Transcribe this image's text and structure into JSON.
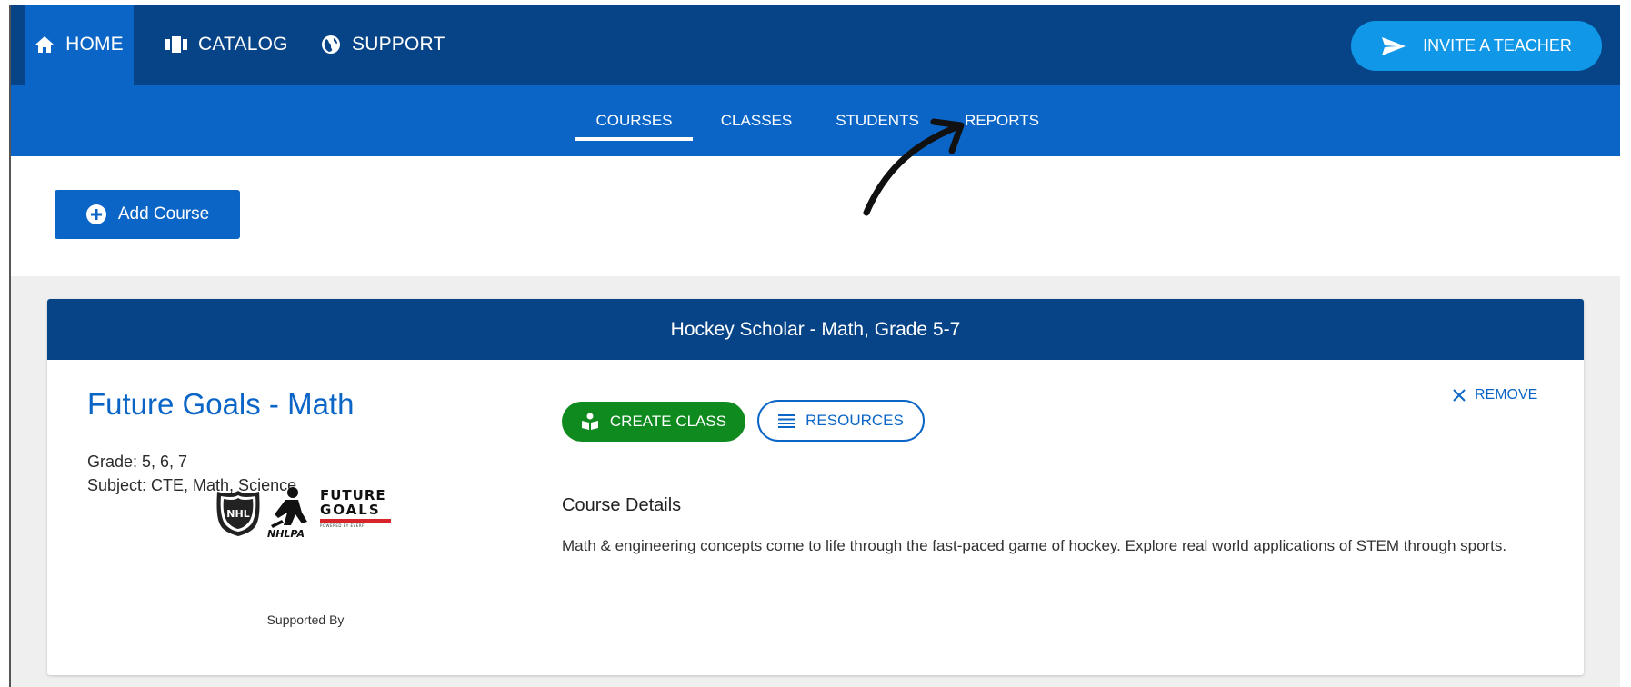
{
  "topnav": {
    "items": [
      {
        "label": "HOME",
        "icon": "home-icon",
        "active": true
      },
      {
        "label": "CATALOG",
        "icon": "catalog-icon",
        "active": false
      },
      {
        "label": "SUPPORT",
        "icon": "globe-icon",
        "active": false
      }
    ],
    "invite_label": "INVITE A TEACHER",
    "invite_icon": "send-icon"
  },
  "subnav": {
    "tabs": [
      {
        "label": "COURSES",
        "active": true
      },
      {
        "label": "CLASSES",
        "active": false
      },
      {
        "label": "STUDENTS",
        "active": false
      },
      {
        "label": "REPORTS",
        "active": false
      }
    ]
  },
  "toolbar": {
    "add_course_label": "Add Course",
    "add_icon": "plus-circle-icon"
  },
  "course": {
    "header": "Hockey Scholar - Math, Grade 5-7",
    "title": "Future Goals - Math",
    "grade": "Grade: 5, 6, 7",
    "subject": "Subject: CTE, Math, Science",
    "supported_by": "Supported By",
    "logos": {
      "nhl": "NHL",
      "nhlpa": "NHLPA",
      "future_line1": "FUTURE",
      "future_line2": "GOALS",
      "powered": "POWERED BY EVERFI"
    },
    "create_class_label": "CREATE CLASS",
    "resources_label": "RESOURCES",
    "remove_label": "REMOVE",
    "details_heading": "Course Details",
    "details_text": "Math & engineering concepts come to life through the fast-paced game of hockey. Explore real world applications of STEM through sports."
  },
  "colors": {
    "nav_dark": "#074487",
    "nav_blue": "#0a65c6",
    "invite_blue": "#1097e7",
    "create_green": "#0f8a1f"
  }
}
